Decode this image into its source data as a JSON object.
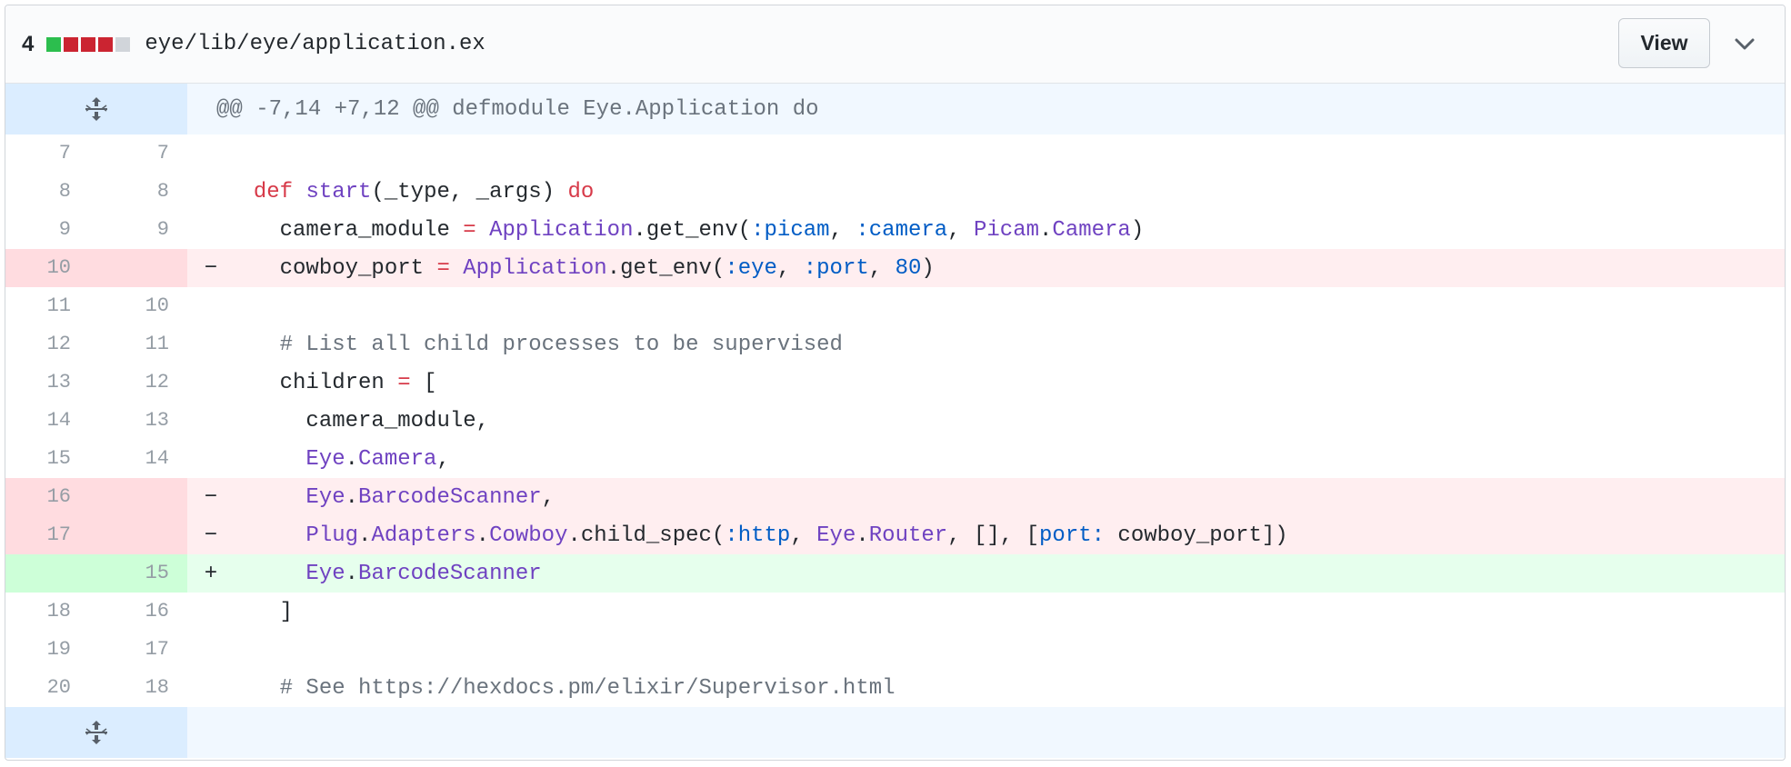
{
  "file_header": {
    "changes_count": "4",
    "diffstat": [
      "#2cbe4e",
      "#cb2431",
      "#cb2431",
      "#cb2431",
      "#d1d5da"
    ],
    "path": "eye/lib/eye/application.ex",
    "view_label": "View"
  },
  "hunk": {
    "header": "@@ -7,14 +7,12 @@ defmodule Eye.Application do"
  },
  "lines": [
    {
      "type": "ctx",
      "old": "7",
      "new": "7",
      "marker": "",
      "tokens": [
        {
          "t": "",
          "c": ""
        }
      ]
    },
    {
      "type": "ctx",
      "old": "8",
      "new": "8",
      "marker": "",
      "tokens": [
        {
          "t": "  ",
          "c": ""
        },
        {
          "t": "def",
          "c": "kw"
        },
        {
          "t": " ",
          "c": ""
        },
        {
          "t": "start",
          "c": "fn"
        },
        {
          "t": "(_type, _args) ",
          "c": ""
        },
        {
          "t": "do",
          "c": "kw"
        }
      ]
    },
    {
      "type": "ctx",
      "old": "9",
      "new": "9",
      "marker": "",
      "tokens": [
        {
          "t": "    camera_module ",
          "c": ""
        },
        {
          "t": "=",
          "c": "op"
        },
        {
          "t": " ",
          "c": ""
        },
        {
          "t": "Application",
          "c": "mod"
        },
        {
          "t": ".get_env(",
          "c": ""
        },
        {
          "t": ":picam",
          "c": "atom"
        },
        {
          "t": ", ",
          "c": ""
        },
        {
          "t": ":camera",
          "c": "atom"
        },
        {
          "t": ", ",
          "c": ""
        },
        {
          "t": "Picam",
          "c": "mod"
        },
        {
          "t": ".",
          "c": ""
        },
        {
          "t": "Camera",
          "c": "mod"
        },
        {
          "t": ")",
          "c": ""
        }
      ]
    },
    {
      "type": "del",
      "old": "10",
      "new": "",
      "marker": "-",
      "tokens": [
        {
          "t": "    cowboy_port ",
          "c": ""
        },
        {
          "t": "=",
          "c": "op"
        },
        {
          "t": " ",
          "c": ""
        },
        {
          "t": "Application",
          "c": "mod"
        },
        {
          "t": ".get_env(",
          "c": ""
        },
        {
          "t": ":eye",
          "c": "atom"
        },
        {
          "t": ", ",
          "c": ""
        },
        {
          "t": ":port",
          "c": "atom"
        },
        {
          "t": ", ",
          "c": ""
        },
        {
          "t": "80",
          "c": "num-lit"
        },
        {
          "t": ")",
          "c": ""
        }
      ]
    },
    {
      "type": "ctx",
      "old": "11",
      "new": "10",
      "marker": "",
      "tokens": [
        {
          "t": "",
          "c": ""
        }
      ]
    },
    {
      "type": "ctx",
      "old": "12",
      "new": "11",
      "marker": "",
      "tokens": [
        {
          "t": "    ",
          "c": ""
        },
        {
          "t": "# List all child processes to be supervised",
          "c": "cmt"
        }
      ]
    },
    {
      "type": "ctx",
      "old": "13",
      "new": "12",
      "marker": "",
      "tokens": [
        {
          "t": "    children ",
          "c": ""
        },
        {
          "t": "=",
          "c": "op"
        },
        {
          "t": " [",
          "c": ""
        }
      ]
    },
    {
      "type": "ctx",
      "old": "14",
      "new": "13",
      "marker": "",
      "tokens": [
        {
          "t": "      camera_module,",
          "c": ""
        }
      ]
    },
    {
      "type": "ctx",
      "old": "15",
      "new": "14",
      "marker": "",
      "tokens": [
        {
          "t": "      ",
          "c": ""
        },
        {
          "t": "Eye",
          "c": "mod"
        },
        {
          "t": ".",
          "c": ""
        },
        {
          "t": "Camera",
          "c": "mod"
        },
        {
          "t": ",",
          "c": ""
        }
      ]
    },
    {
      "type": "del",
      "old": "16",
      "new": "",
      "marker": "-",
      "tokens": [
        {
          "t": "      ",
          "c": ""
        },
        {
          "t": "Eye",
          "c": "mod"
        },
        {
          "t": ".",
          "c": ""
        },
        {
          "t": "BarcodeScanner",
          "c": "mod"
        },
        {
          "t": ",",
          "c": ""
        }
      ]
    },
    {
      "type": "del",
      "old": "17",
      "new": "",
      "marker": "-",
      "tokens": [
        {
          "t": "      ",
          "c": ""
        },
        {
          "t": "Plug",
          "c": "mod"
        },
        {
          "t": ".",
          "c": ""
        },
        {
          "t": "Adapters",
          "c": "mod"
        },
        {
          "t": ".",
          "c": ""
        },
        {
          "t": "Cowboy",
          "c": "mod"
        },
        {
          "t": ".child_spec(",
          "c": ""
        },
        {
          "t": ":http",
          "c": "atom"
        },
        {
          "t": ", ",
          "c": ""
        },
        {
          "t": "Eye",
          "c": "mod"
        },
        {
          "t": ".",
          "c": ""
        },
        {
          "t": "Router",
          "c": "mod"
        },
        {
          "t": ", [], [",
          "c": ""
        },
        {
          "t": "port:",
          "c": "atom"
        },
        {
          "t": " cowboy_port])",
          "c": ""
        }
      ]
    },
    {
      "type": "add",
      "old": "",
      "new": "15",
      "marker": "+",
      "tokens": [
        {
          "t": "      ",
          "c": ""
        },
        {
          "t": "Eye",
          "c": "mod"
        },
        {
          "t": ".",
          "c": ""
        },
        {
          "t": "BarcodeScanner",
          "c": "mod"
        }
      ]
    },
    {
      "type": "ctx",
      "old": "18",
      "new": "16",
      "marker": "",
      "tokens": [
        {
          "t": "    ]",
          "c": ""
        }
      ]
    },
    {
      "type": "ctx",
      "old": "19",
      "new": "17",
      "marker": "",
      "tokens": [
        {
          "t": "",
          "c": ""
        }
      ]
    },
    {
      "type": "ctx",
      "old": "20",
      "new": "18",
      "marker": "",
      "tokens": [
        {
          "t": "    ",
          "c": ""
        },
        {
          "t": "# See https://hexdocs.pm/elixir/Supervisor.html",
          "c": "cmt"
        }
      ]
    }
  ],
  "icons": {
    "expand_up": "expand-icon",
    "expand_down": "expand-icon",
    "collapse": "chevron-down-icon"
  }
}
